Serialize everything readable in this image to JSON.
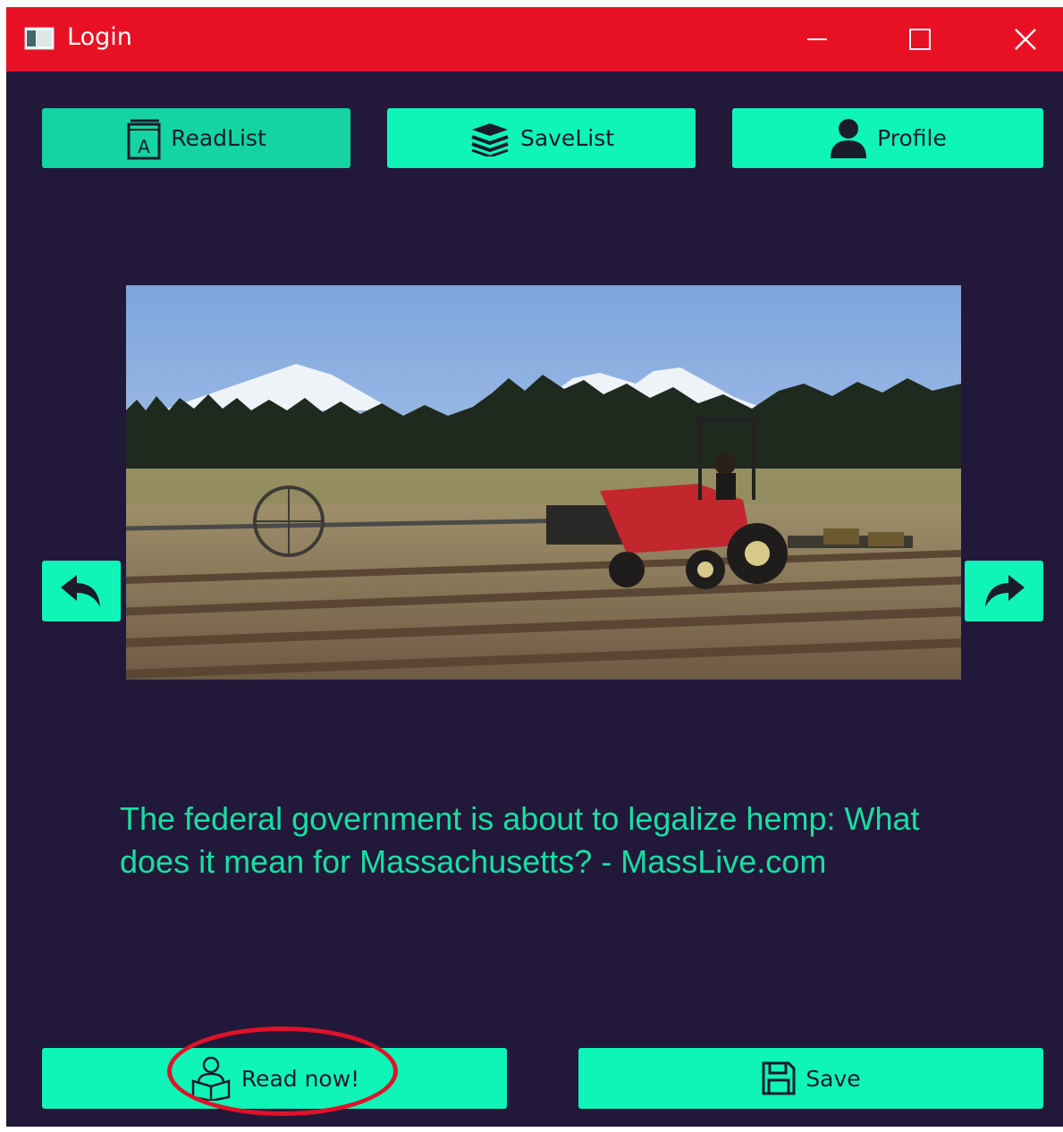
{
  "window": {
    "title": "Login",
    "title_bar_color": "#e81123",
    "background": "#22183a",
    "accent": "#0ff5b8",
    "text_accent": "#18dfa2"
  },
  "nav": [
    {
      "label": "ReadList",
      "icon": "book-a-icon",
      "active": true
    },
    {
      "label": "SaveList",
      "icon": "stack-icon",
      "active": false
    },
    {
      "label": "Profile",
      "icon": "user-icon",
      "active": false
    }
  ],
  "article": {
    "image": "farm-tractor-photo",
    "headline": "The federal government is about to legalize hemp: What does it mean for Massachusetts? - MassLive.com"
  },
  "carousel": {
    "prev_icon": "arrow-back-icon",
    "next_icon": "arrow-forward-icon"
  },
  "actions": {
    "read_label": "Read now!",
    "read_icon": "reader-icon",
    "save_label": "Save",
    "save_icon": "floppy-disk-icon",
    "highlight": "red-circle-annotation"
  }
}
